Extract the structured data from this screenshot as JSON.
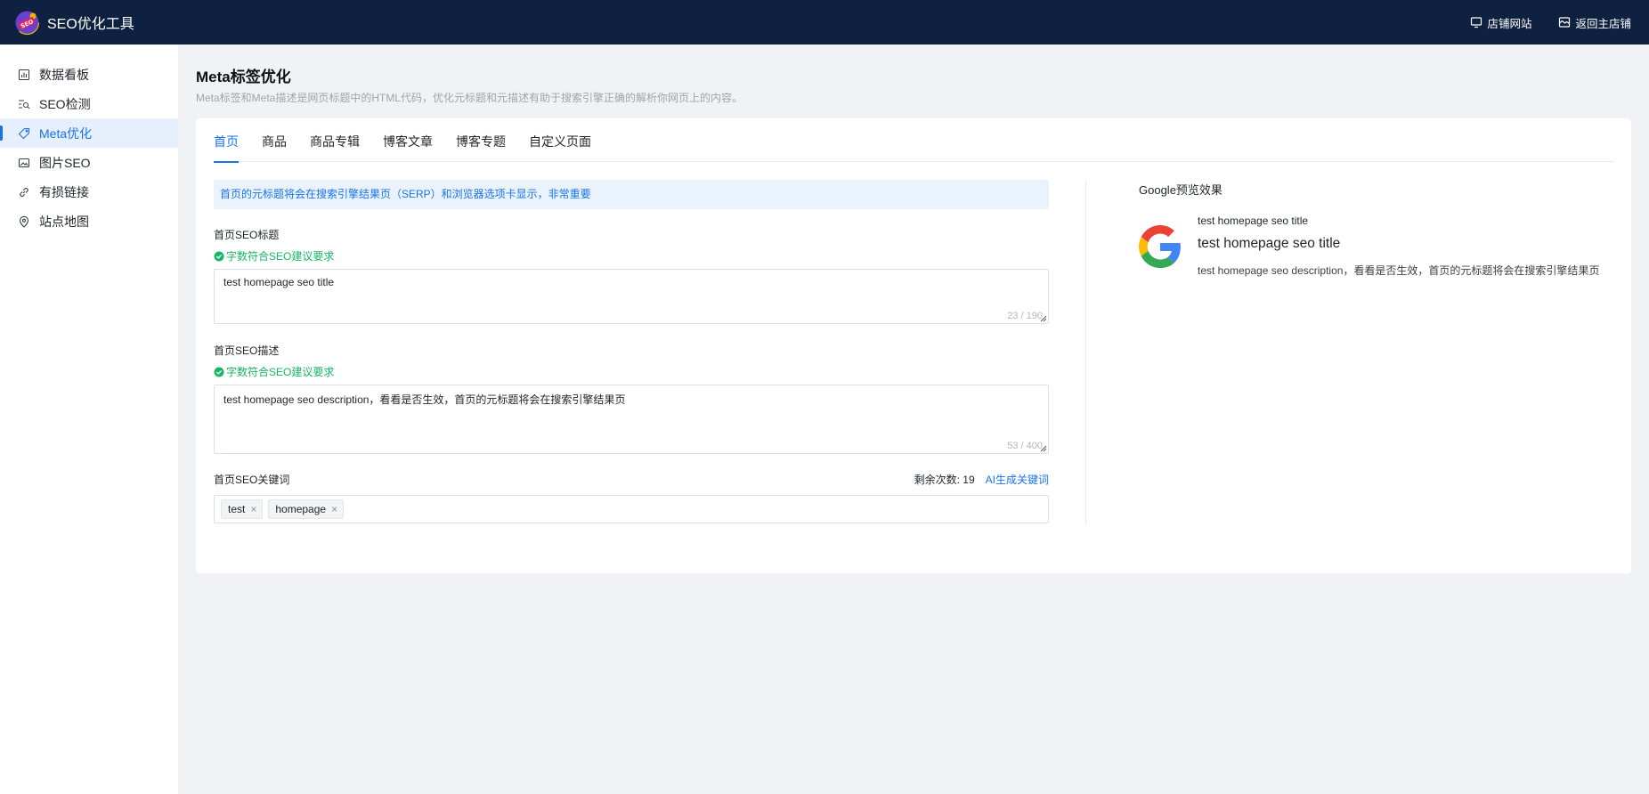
{
  "app": {
    "title": "SEO优化工具",
    "logo_text": "SEO"
  },
  "top_actions": [
    {
      "label": "店铺网站",
      "icon": "monitor-icon"
    },
    {
      "label": "返回主店铺",
      "icon": "store-icon"
    }
  ],
  "sidebar": {
    "items": [
      {
        "label": "数据看板",
        "icon": "chart-board-icon",
        "active": false
      },
      {
        "label": "SEO检测",
        "icon": "seo-scan-icon",
        "active": false
      },
      {
        "label": "Meta优化",
        "icon": "tag-icon",
        "active": true
      },
      {
        "label": "图片SEO",
        "icon": "image-icon",
        "active": false
      },
      {
        "label": "有损链接",
        "icon": "link-icon",
        "active": false
      },
      {
        "label": "站点地图",
        "icon": "location-pin-icon",
        "active": false
      }
    ]
  },
  "page": {
    "title": "Meta标签优化",
    "subtitle": "Meta标签和Meta描述是网页标题中的HTML代码，优化元标题和元描述有助于搜索引擎正确的解析你网页上的内容。"
  },
  "tabs": [
    {
      "label": "首页",
      "active": true
    },
    {
      "label": "商品",
      "active": false
    },
    {
      "label": "商品专辑",
      "active": false
    },
    {
      "label": "博客文章",
      "active": false
    },
    {
      "label": "博客专题",
      "active": false
    },
    {
      "label": "自定义页面",
      "active": false
    }
  ],
  "form": {
    "notice": "首页的元标题将会在搜索引擎结果页（SERP）和浏览器选项卡显示，非常重要",
    "title_field": {
      "label": "首页SEO标题",
      "status": "字数符合SEO建议要求",
      "value": "test homepage seo title",
      "counter": "23 / 190"
    },
    "desc_field": {
      "label": "首页SEO描述",
      "status": "字数符合SEO建议要求",
      "value": "test homepage seo description，看看是否生效，首页的元标题将会在搜索引擎结果页",
      "counter": "53 / 400"
    },
    "keywords": {
      "label": "首页SEO关键词",
      "remain_label": "剩余次数:",
      "remain_count": "19",
      "ai_link": "AI生成关键词",
      "tags": [
        "test",
        "homepage"
      ]
    }
  },
  "preview": {
    "heading": "Google预览效果",
    "url_line": "test homepage seo title",
    "title": "test homepage seo title",
    "description": "test homepage seo description，看看是否生效，首页的元标题将会在搜索引擎结果页"
  },
  "colors": {
    "topbar": "#0f2140",
    "accent": "#1a73e8",
    "success": "#18b566"
  }
}
